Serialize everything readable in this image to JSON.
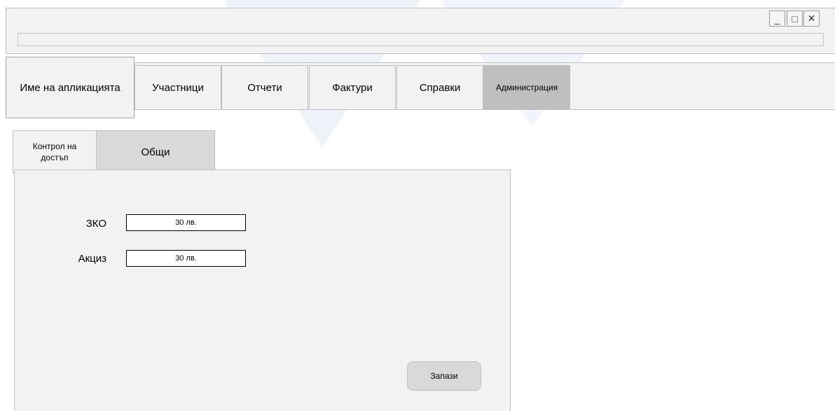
{
  "app": {
    "name": "Име на апликацията"
  },
  "window_controls": {
    "minimize": "_",
    "maximize": "□",
    "close": "✕"
  },
  "nav": {
    "tabs": [
      {
        "label": "Участници"
      },
      {
        "label": "Отчети"
      },
      {
        "label": "Фактури"
      },
      {
        "label": "Справки"
      },
      {
        "label": "Администрация",
        "active": true
      }
    ]
  },
  "subtabs": {
    "access_line1": "Контрол на",
    "access_line2": "достъп",
    "general": "Общи"
  },
  "form": {
    "zko_label": "ЗКО",
    "zko_value": "30 лв.",
    "excise_label": "Акциз",
    "excise_value": "30 лв.",
    "save_label": "Запази"
  },
  "colors": {
    "panel_bg": "#f2f2f2",
    "active_tab": "#bfbfbf",
    "subtab_active": "#d9d9d9",
    "border": "#bfbfbf"
  }
}
